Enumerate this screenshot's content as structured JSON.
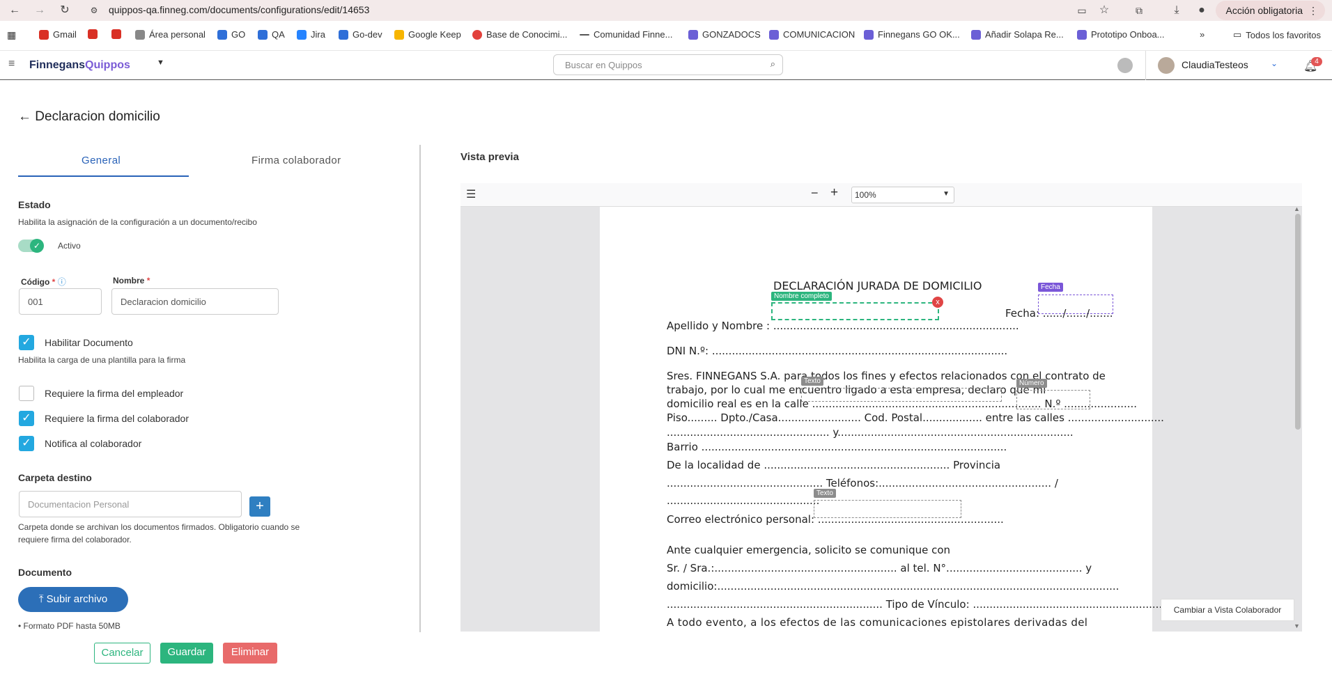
{
  "browser": {
    "url": "quippos-qa.finneg.com/documents/configurations/edit/14653",
    "action_pill": "Acción obligatoria",
    "bookmarks": [
      "Gmail",
      "Área personal",
      "GO",
      "QA",
      "Jira",
      "Go-dev",
      "Google Keep",
      "Base de Conocimi...",
      "Comunidad Finne...",
      "GONZADOCS",
      "COMUNICACION",
      "Finnegans GO OK...",
      "Añadir Solapa Re...",
      "Prototipo Onboa..."
    ],
    "all_bookmarks": "Todos los favoritos"
  },
  "header": {
    "logo_main": "Finnegans",
    "logo_sub": "Quippos",
    "search_placeholder": "Buscar en Quippos",
    "user_name": "ClaudiaTesteos",
    "notifications": "4"
  },
  "page": {
    "title": "Declaracion domicilio",
    "tabs": [
      "General",
      "Firma colaborador"
    ]
  },
  "form": {
    "estado_title": "Estado",
    "estado_desc": "Habilita la asignación de la configuración a un documento/recibo",
    "activo_label": "Activo",
    "codigo_label": "Código",
    "codigo_value": "001",
    "nombre_label": "Nombre",
    "nombre_value": "Declaracion domicilio",
    "habilitar_doc": "Habilitar Documento",
    "habilitar_desc": "Habilita la carga de una plantilla para la firma",
    "req_empleador": "Requiere la firma del empleador",
    "req_colaborador": "Requiere la firma del colaborador",
    "notifica": "Notifica al colaborador",
    "carpeta_title": "Carpeta destino",
    "carpeta_placeholder": "Documentacion Personal",
    "carpeta_desc_1": "Carpeta donde se archivan los documentos firmados. Obligatorio cuando se",
    "carpeta_desc_2": "requiere firma del colaborador.",
    "documento_title": "Documento",
    "subir_archivo": "Subir archivo",
    "formato": "Formato PDF hasta 50MB",
    "cancelar": "Cancelar",
    "guardar": "Guardar",
    "eliminar": "Eliminar",
    "checkboxes": {
      "habilitar": true,
      "empleador": false,
      "colaborador": true,
      "notifica": true
    }
  },
  "preview": {
    "title": "Vista previa",
    "zoom": "100%",
    "switch_view": "Cambiar a Vista Colaborador",
    "doc_title": "DECLARACIÓN JURADA DE DOMICILIO",
    "tags": {
      "nombre": "Nombre completo",
      "fecha": "Fecha",
      "texto": "Texto",
      "numero": "Número"
    },
    "lines": [
      "Fecha: ....../....../.......",
      "Apellido y Nombre : ..........................................................................",
      "DNI N.º: .........................................................................................",
      "Sres. FINNEGANS S.A. para todos los fines y efectos relacionados con el contrato de",
      "trabajo, por lo cual me encuentro ligado a esta empresa, declaro que mi",
      "domicilio real es en la calle ..................................................................... N.º ......................",
      "Piso......... Dpto./Casa......................... Cod. Postal.................. entre las calles .............................",
      "................................................. y.......................................................................",
      "Barrio ............................................................................................",
      "De la localidad de ........................................................ Provincia",
      "............................................... Teléfonos:.................................................... /",
      "..............................................",
      "Correo electrónico personal: ........................................................",
      "Ante cualquier emergencia, solicito se comunique con",
      "Sr. / Sra.:....................................................... al tel. N°......................................... y",
      "domicilio:.........................................................................................................................",
      "................................................................. Tipo de Vínculo: ...............................................................",
      "A todo evento, a los efectos de las comunicaciones epistolares derivadas del"
    ]
  }
}
